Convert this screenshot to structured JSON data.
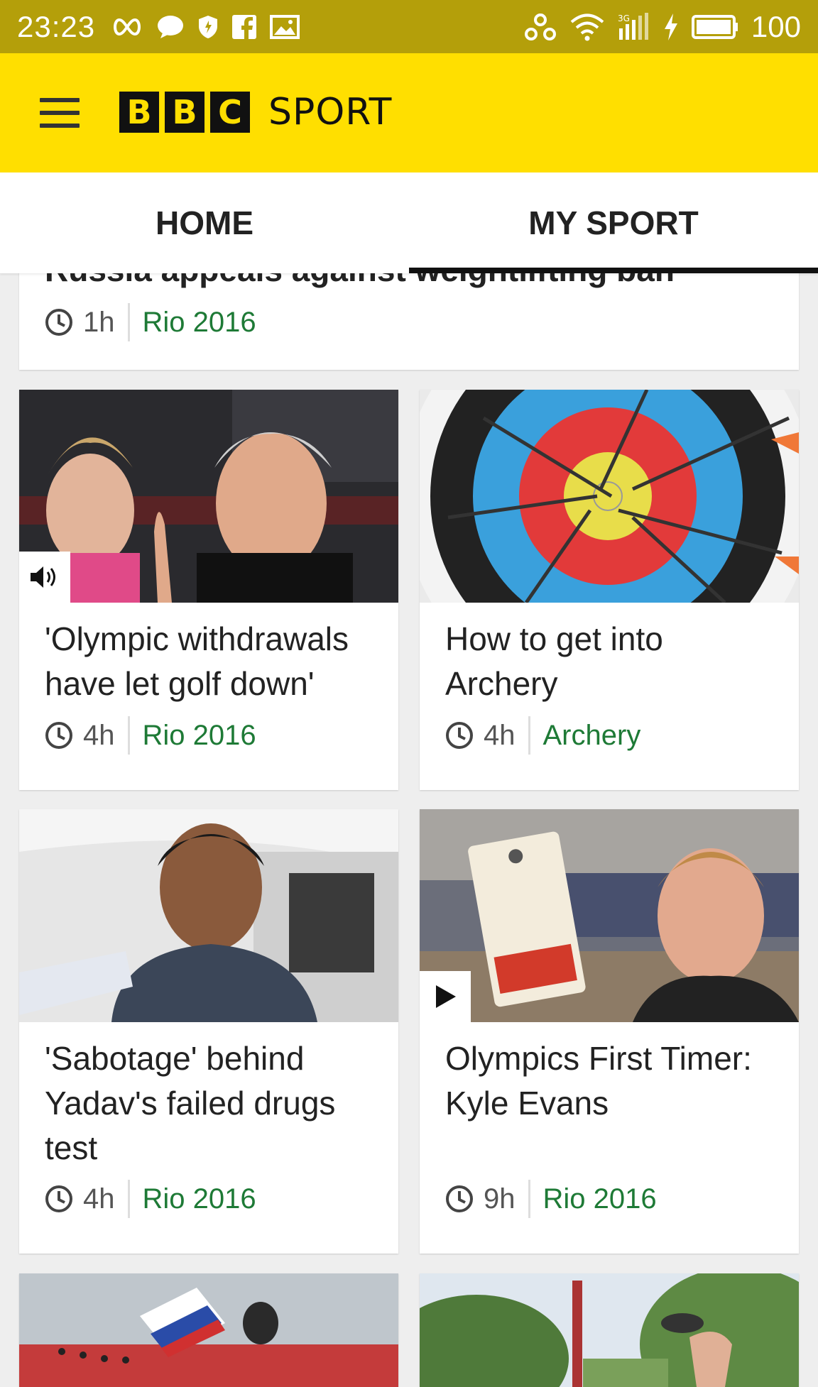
{
  "status_bar": {
    "time": "23:23",
    "battery": "100"
  },
  "header": {
    "brand_letters": [
      "B",
      "B",
      "C"
    ],
    "brand_word": "SPORT"
  },
  "tabs": [
    {
      "label": "HOME"
    },
    {
      "label": "MY SPORT"
    }
  ],
  "partial_story": {
    "title": "Russia appeals against weightlifting ban",
    "time": "1h",
    "topic": "Rio 2016"
  },
  "stories": [
    {
      "title": "'Olympic withdrawals have let golf down'",
      "time": "4h",
      "topic": "Rio 2016",
      "media": "audio-icon"
    },
    {
      "title": "How to get into Archery",
      "time": "4h",
      "topic": "Archery",
      "media": ""
    },
    {
      "title": "'Sabotage' behind Yadav's failed drugs test",
      "time": "4h",
      "topic": "Rio 2016",
      "media": ""
    },
    {
      "title": "Olympics First Timer: Kyle Evans",
      "time": "9h",
      "topic": "Rio 2016",
      "media": "play-icon"
    }
  ],
  "colors": {
    "status_bar": "#b49f0a",
    "header": "#ffdf00",
    "topic": "#1e7a36"
  }
}
